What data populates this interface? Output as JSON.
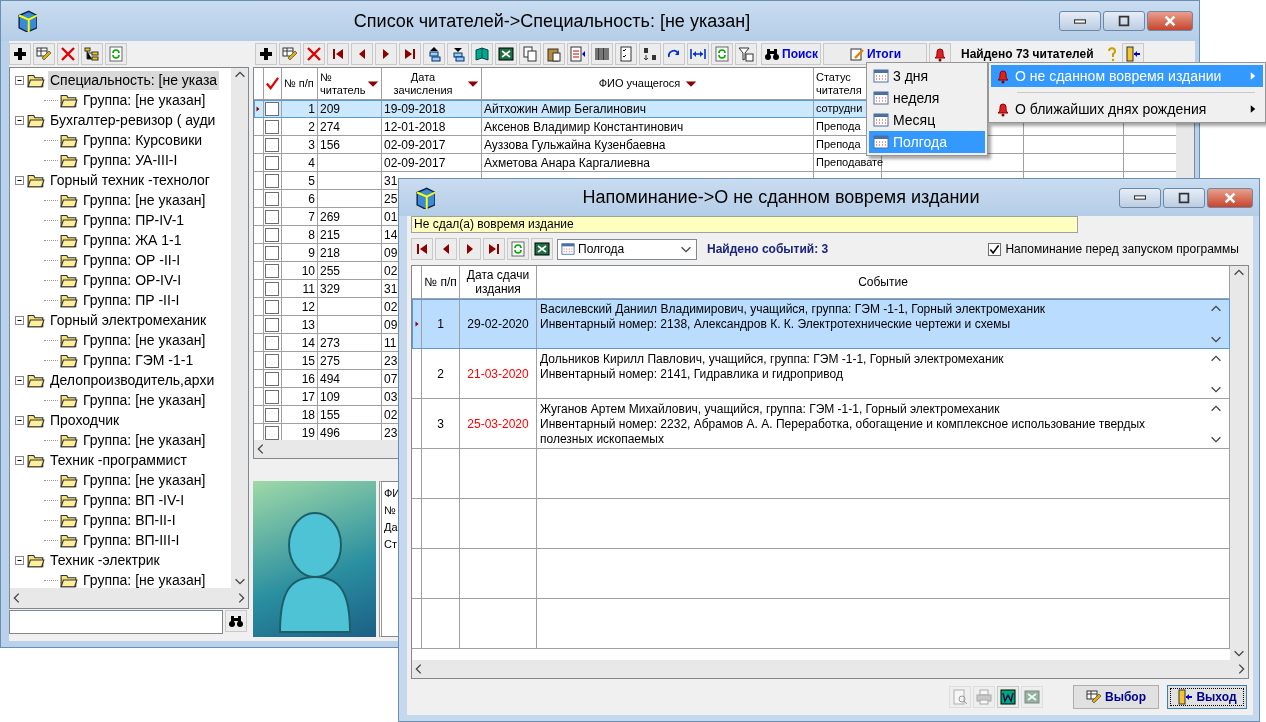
{
  "main_window": {
    "title": "Список читателей->Специальность: [не указан]",
    "tree": [
      {
        "label": "Специальность: [не указа",
        "selected": true,
        "expanded": true,
        "children": [
          {
            "label": "Группа: [не указан]",
            "selected": false
          }
        ]
      },
      {
        "label": "Бухгалтер-ревизор ( ауди",
        "selected": false,
        "expanded": true,
        "children": [
          {
            "label": "Группа: Курсовики",
            "selected": false
          },
          {
            "label": "Группа: УА-III-I",
            "selected": false
          }
        ]
      },
      {
        "label": "Горный техник -технолог",
        "selected": false,
        "expanded": true,
        "children": [
          {
            "label": "Группа: [не указан]",
            "selected": false
          },
          {
            "label": "Группа: ПР-IV-1",
            "selected": false
          },
          {
            "label": "Группа: ЖА 1-1",
            "selected": false
          },
          {
            "label": "Группа: ОР -II-I",
            "selected": false
          },
          {
            "label": "Группа: ОР-IV-I",
            "selected": false
          },
          {
            "label": "Группа: ПР -II-I",
            "selected": false
          }
        ]
      },
      {
        "label": "Горный электромеханик",
        "selected": false,
        "expanded": true,
        "children": [
          {
            "label": "Группа: [не указан]",
            "selected": false
          },
          {
            "label": "Группа: ГЭМ -1-1",
            "selected": false
          }
        ]
      },
      {
        "label": "Делопроизводитель,архи",
        "selected": false,
        "expanded": true,
        "children": [
          {
            "label": "Группа: [не указан]",
            "selected": false
          }
        ]
      },
      {
        "label": "Проходчик",
        "selected": false,
        "expanded": true,
        "children": [
          {
            "label": "Группа: [не указан]",
            "selected": false
          }
        ]
      },
      {
        "label": "Техник -программист",
        "selected": false,
        "expanded": true,
        "children": [
          {
            "label": "Группа: [не указан]",
            "selected": false
          },
          {
            "label": "Группа: ВП -IV-I",
            "selected": false
          },
          {
            "label": "Группа: ВП-II-I",
            "selected": false
          },
          {
            "label": "Группа: ВП-III-I",
            "selected": false
          }
        ]
      },
      {
        "label": "Техник -электрик",
        "selected": false,
        "expanded": true,
        "children": [
          {
            "label": "Группа: [не указан]",
            "selected": false
          }
        ]
      }
    ],
    "toolbar": {
      "search_button": "Поиск",
      "totals_button": "Итоги",
      "found": "Найдено 73 читателей"
    },
    "table": {
      "columns": [
        {
          "label": "№ п/п",
          "sort": false
        },
        {
          "label": "№ читатель",
          "sort": true
        },
        {
          "label": "Дата зачисления",
          "sort": true
        },
        {
          "label": "ФИО учащегося",
          "sort": true
        },
        {
          "label": "Статус читателя",
          "sort": false
        }
      ],
      "rows": [
        {
          "n": "1",
          "reader": "209",
          "date": "19-09-2018",
          "name": "Айтхожин Амир Бегалинович",
          "status": "сотрудни",
          "checked": false,
          "selected": true
        },
        {
          "n": "2",
          "reader": "274",
          "date": "12-01-2018",
          "name": "Аксенов Владимир Константинович",
          "status": "Препода",
          "checked": false,
          "selected": false
        },
        {
          "n": "3",
          "reader": "156",
          "date": "02-09-2017",
          "name": "Ауззова Гульжайна Кузенбаевна",
          "status": "Препода",
          "checked": false,
          "selected": false
        },
        {
          "n": "4",
          "date": "02-09-2017",
          "name": "Ахметова Анара Каргалиевна",
          "status": "Преподавате",
          "checked": false,
          "selected": false
        },
        {
          "n": "5",
          "date": "31",
          "checked": false,
          "selected": false
        },
        {
          "n": "6",
          "date": "25",
          "checked": false,
          "selected": false
        },
        {
          "n": "7",
          "reader": "269",
          "date": "01",
          "checked": false,
          "selected": false
        },
        {
          "n": "8",
          "reader": "215",
          "date": "14",
          "checked": false,
          "selected": false
        },
        {
          "n": "9",
          "reader": "218",
          "date": "09",
          "checked": false,
          "selected": false
        },
        {
          "n": "10",
          "reader": "255",
          "date": "02",
          "checked": false,
          "selected": false
        },
        {
          "n": "11",
          "reader": "329",
          "date": "31",
          "checked": false,
          "selected": false
        },
        {
          "n": "12",
          "date": "02",
          "checked": false,
          "selected": false
        },
        {
          "n": "13",
          "date": "09",
          "checked": false,
          "selected": false
        },
        {
          "n": "14",
          "reader": "273",
          "date": "11",
          "checked": false,
          "selected": false
        },
        {
          "n": "15",
          "reader": "275",
          "date": "23",
          "checked": false,
          "selected": false
        },
        {
          "n": "16",
          "reader": "494",
          "date": "07",
          "checked": false,
          "selected": false
        },
        {
          "n": "17",
          "reader": "109",
          "date": "03",
          "checked": false,
          "selected": false
        },
        {
          "n": "18",
          "reader": "155",
          "date": "02",
          "checked": false,
          "selected": false
        },
        {
          "n": "19",
          "reader": "496",
          "date": "23",
          "checked": false,
          "selected": false
        }
      ]
    },
    "card": {
      "lines": [
        "ФИ",
        "№",
        "Да",
        "Ст"
      ]
    }
  },
  "period_menu": {
    "items": [
      {
        "label": "3 дня",
        "selected": false
      },
      {
        "label": "неделя",
        "selected": false
      },
      {
        "label": "Месяц",
        "selected": false
      },
      {
        "label": "Полгода",
        "selected": true
      }
    ]
  },
  "reminder_menu": {
    "items": [
      {
        "label": "О не сданном вовремя издании",
        "selected": true
      },
      {
        "label": "О ближайших днях рождения",
        "selected": false
      }
    ]
  },
  "dialog": {
    "title": "Напоминание->О не сданном вовремя издании",
    "caption": "Не сдал(а) вовремя издание",
    "period": "Полгода",
    "found": "Найдено событий: 3",
    "remind_on_start": {
      "label": "Напоминание перед запуском программы",
      "checked": true
    },
    "table": {
      "columns": [
        "№ п/п",
        "Дата сдачи издания",
        "Событие"
      ],
      "rows": [
        {
          "n": "1",
          "date": "29-02-2020",
          "color": "#000000",
          "selected": true,
          "lines": [
            "Василевский Даниил Владимирович, учащийся, группа: ГЭМ -1-1, Горный электромеханик",
            "Инвентарный номер: 2138, Александров К. К. Электротехнические чертежи и схемы"
          ]
        },
        {
          "n": "2",
          "date": "21-03-2020",
          "color": "#ff0000",
          "selected": false,
          "lines": [
            "Дольников Кирилл Павлович, учащийся, группа: ГЭМ -1-1, Горный электромеханик",
            "Инвентарный номер: 2141, Гидравлика и гидропривод"
          ]
        },
        {
          "n": "3",
          "date": "25-03-2020",
          "color": "#ff0000",
          "selected": false,
          "lines": [
            "Жуганов Артем Михайлович, учащийся, группа: ГЭМ -1-1, Горный электромеханик",
            "Инвентарный номер: 2232, Абрамов А. А. Переработка, обогащение и комплексное использование твердых полезных ископаемых"
          ]
        }
      ]
    },
    "tools": [
      {
        "kind": "preview",
        "disabled": true
      },
      {
        "kind": "print",
        "disabled": true
      },
      {
        "kind": "word",
        "disabled": false
      },
      {
        "kind": "spreadsheet",
        "disabled": true
      }
    ],
    "buttons": [
      {
        "kind": "select",
        "label": "Выбор"
      },
      {
        "kind": "exit",
        "label": "Выход"
      }
    ]
  }
}
